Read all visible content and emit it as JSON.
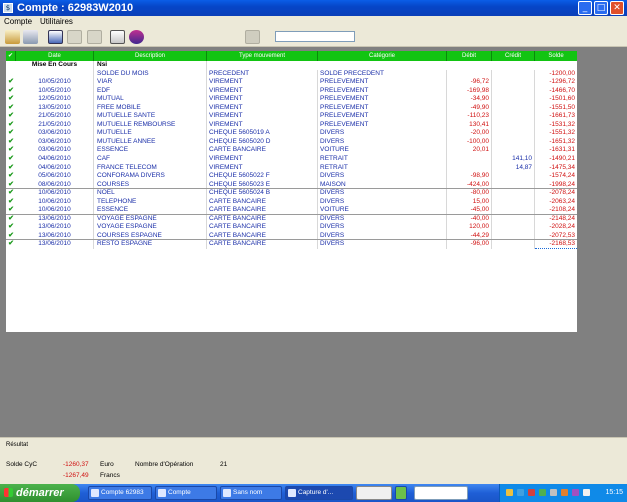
{
  "window": {
    "title": "Compte : 62983W2010",
    "app_icon": "bank-app-icon",
    "min": "_",
    "max": "□",
    "close": "✕"
  },
  "menu": [
    "Compte",
    "Utilitaires"
  ],
  "grid": {
    "headers": [
      "✔",
      "Date",
      "Description",
      "Type mouvement",
      "Catégorie",
      "Débit",
      "Crédit",
      "Solde"
    ],
    "subheader": {
      "date": "Mise En Cours",
      "lib": "Nsi"
    },
    "rows": [
      {
        "chk": "",
        "date": "",
        "lib": "SOLDE DU MOIS",
        "type": "PRECEDENT",
        "cat": "SOLDE PRECEDENT",
        "deb": "",
        "cred": "",
        "solde": "-1200,00"
      },
      {
        "chk": "✔",
        "date": "10/05/2010",
        "lib": "VIAR",
        "type": "VIREMENT",
        "cat": "PRELEVEMENT",
        "deb": "-96,72",
        "cred": "",
        "solde": "-1296,72"
      },
      {
        "chk": "✔",
        "date": "10/05/2010",
        "lib": "EDF",
        "type": "VIREMENT",
        "cat": "PRELEVEMENT",
        "deb": "-169,98",
        "cred": "",
        "solde": "-1466,70"
      },
      {
        "chk": "✔",
        "date": "12/05/2010",
        "lib": "MUTUAL",
        "type": "VIREMENT",
        "cat": "PRELEVEMENT",
        "deb": "-34,90",
        "cred": "",
        "solde": "-1501,60"
      },
      {
        "chk": "✔",
        "date": "13/05/2010",
        "lib": "FREE MOBILE",
        "type": "VIREMENT",
        "cat": "PRELEVEMENT",
        "deb": "-49,90",
        "cred": "",
        "solde": "-1551,50"
      },
      {
        "chk": "✔",
        "date": "21/05/2010",
        "lib": "MUTUELLE SANTE",
        "type": "VIREMENT",
        "cat": "PRELEVEMENT",
        "deb": "-110,23",
        "cred": "",
        "solde": "-1661,73"
      },
      {
        "chk": "✔",
        "date": "21/05/2010",
        "lib": "MUTUELLE REMBOURSE",
        "type": "VIREMENT",
        "cat": "PRELEVEMENT",
        "deb": "130,41",
        "cred": "",
        "solde": "-1531,32"
      },
      {
        "chk": "✔",
        "date": "03/06/2010",
        "lib": "MUTUELLE",
        "type": "CHEQUE 5605019 A",
        "cat": "DIVERS",
        "deb": "-20,00",
        "cred": "",
        "solde": "-1551,32"
      },
      {
        "chk": "✔",
        "date": "03/06/2010",
        "lib": "MUTUELLE ANNEE",
        "type": "CHEQUE 5605020 D",
        "cat": "DIVERS",
        "deb": "-100,00",
        "cred": "",
        "solde": "-1651,32"
      },
      {
        "chk": "✔",
        "date": "03/06/2010",
        "lib": "ESSENCE",
        "type": "CARTE BANCAIRE",
        "cat": "VOITURE",
        "deb": "20,01",
        "cred": "",
        "solde": "-1631,31"
      },
      {
        "chk": "✔",
        "date": "04/06/2010",
        "lib": "CAF",
        "type": "VIREMENT",
        "cat": "RETRAIT",
        "deb": "",
        "cred": "141,10",
        "solde": "-1490,21"
      },
      {
        "chk": "✔",
        "date": "04/06/2010",
        "lib": "FRANCE TELECOM",
        "type": "VIREMENT",
        "cat": "RETRAIT",
        "deb": "",
        "cred": "14,87",
        "solde": "-1475,34"
      },
      {
        "chk": "✔",
        "date": "05/06/2010",
        "lib": "CONFORAMA DIVERS",
        "type": "CHEQUE 5605022 F",
        "cat": "DIVERS",
        "deb": "-98,90",
        "cred": "",
        "solde": "-1574,24"
      },
      {
        "chk": "✔",
        "date": "08/06/2010",
        "lib": "COURSES",
        "type": "CHEQUE 5605023 E",
        "cat": "MAISON",
        "deb": "-424,00",
        "cred": "",
        "solde": "-1998,24"
      },
      {
        "chk": "✔",
        "date": "10/06/2010",
        "lib": "NOEL",
        "type": "CHEQUE 5605024 B",
        "cat": "DIVERS",
        "deb": "-80,00",
        "cred": "",
        "solde": "-2078,24"
      },
      {
        "chk": "✔",
        "date": "10/06/2010",
        "lib": "TELEPHONE",
        "type": "CARTE BANCAIRE",
        "cat": "DIVERS",
        "deb": "15,00",
        "cred": "",
        "solde": "-2063,24"
      },
      {
        "chk": "✔",
        "date": "10/06/2010",
        "lib": "ESSENCE",
        "type": "CARTE BANCAIRE",
        "cat": "VOITURE",
        "deb": "-45,00",
        "cred": "",
        "solde": "-2108,24"
      },
      {
        "chk": "✔",
        "date": "13/06/2010",
        "lib": "VOYAGE ESPAGNE",
        "type": "CARTE BANCAIRE",
        "cat": "DIVERS",
        "deb": "-40,00",
        "cred": "",
        "solde": "-2148,24"
      },
      {
        "chk": "✔",
        "date": "13/06/2010",
        "lib": "VOYAGE ESPAGNE",
        "type": "CARTE BANCAIRE",
        "cat": "DIVERS",
        "deb": "120,00",
        "cred": "",
        "solde": "-2028,24"
      },
      {
        "chk": "✔",
        "date": "13/06/2010",
        "lib": "COURSES ESPAGNE",
        "type": "CARTE BANCAIRE",
        "cat": "DIVERS",
        "deb": "-44,29",
        "cred": "",
        "solde": "-2072,53"
      },
      {
        "chk": "✔",
        "date": "13/06/2010",
        "lib": "RESTO ESPAGNE",
        "type": "CARTE BANCAIRE",
        "cat": "DIVERS",
        "deb": "-96,00",
        "cred": "",
        "solde": "-2168,53"
      }
    ]
  },
  "summary": {
    "label": "Résultat",
    "solde_label": "Solde CyC",
    "solde_value": "-1260,37",
    "currency_1": "Euro",
    "franc_value": "-1267,49",
    "currency_2": "Francs",
    "ops_label": "Nombre d'Opération",
    "ops_value": "21"
  },
  "taskbar": {
    "start": "démarrer",
    "tasks": [
      "Compte 62983",
      "Compte",
      "Sans nom",
      "Capture d'...",
      "",
      ""
    ],
    "clock": "15:15"
  }
}
